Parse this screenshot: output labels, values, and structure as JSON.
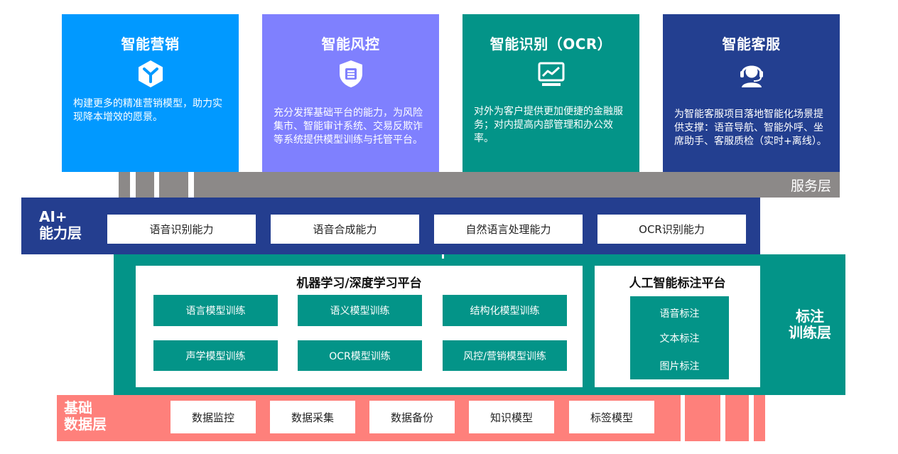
{
  "service_cards": [
    {
      "title": "智能营销",
      "icon": "cube-icon",
      "description": "构建更多的精准营销模型，助力实现降本增效的愿景。",
      "color": "#0199ff"
    },
    {
      "title": "智能风控",
      "icon": "shield-icon",
      "description": "充分发挥基础平台的能力，为风险集市、智能审计系统、交易反欺诈等系统提供模型训练与托管平台。",
      "color": "#7f80fe"
    },
    {
      "title": "智能识别（OCR）",
      "icon": "chart-board-icon",
      "description": "对外为客户提供更加便捷的金融服务；对内提高内部管理和办公效率。",
      "color": "#039488"
    },
    {
      "title": "智能客服",
      "icon": "headset-icon",
      "description": "为智能客服项目落地智能化场景提供支撑：语音导航、智能外呼、坐席助手、客服质检（实时+离线）。",
      "color": "#233f90"
    }
  ],
  "service_layer": {
    "label": "服务层",
    "color": "#8c8988"
  },
  "ai_layer": {
    "label_line1": "AI+",
    "label_line2": "能力层",
    "color": "#243e8f",
    "capabilities": [
      "语音识别能力",
      "语音合成能力",
      "自然语言处理能力",
      "OCR识别能力"
    ]
  },
  "training_layer": {
    "label_line1": "标注",
    "label_line2": "训练层",
    "color": "#039488",
    "ml_platform": {
      "title": "机器学习/深度学习平台",
      "items": [
        "语言模型训练",
        "语义模型训练",
        "结构化模型训练",
        "声学模型训练",
        "OCR模型训练",
        "风控/营销模型训练"
      ]
    },
    "annotation_platform": {
      "title": "人工智能标注平台",
      "items": [
        "语音标注",
        "文本标注",
        "图片标注"
      ]
    }
  },
  "data_layer": {
    "label_line1": "基础",
    "label_line2": "数据层",
    "color": "#fe807b",
    "items": [
      "数据监控",
      "数据采集",
      "数据备份",
      "知识模型",
      "标签模型"
    ]
  }
}
